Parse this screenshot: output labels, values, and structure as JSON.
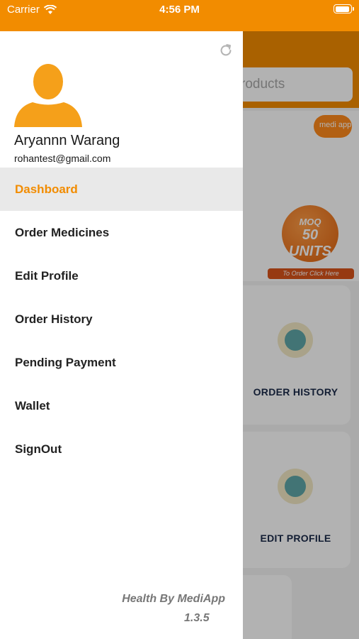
{
  "status_bar": {
    "carrier": "Carrier",
    "time": "4:56 PM",
    "wifi_icon": "wifi-icon",
    "battery_icon": "battery-icon"
  },
  "background": {
    "search_placeholder_partial": "roducts",
    "logo_text": "medi app",
    "moq_line1": "MOQ",
    "moq_line2": "50 UNITS",
    "order_strip": "To Order Click Here",
    "cards": [
      {
        "label": "ORDER HISTORY",
        "icon": "clock-icon"
      },
      {
        "label": "EDIT PROFILE",
        "icon": "profile-icon"
      }
    ]
  },
  "drawer": {
    "refresh_icon": "refresh-icon",
    "avatar_icon": "user-avatar-icon",
    "user_name": "Aryannn Warang",
    "user_email": "rohantest@gmail.com",
    "menu": [
      {
        "label": "Dashboard",
        "active": true
      },
      {
        "label": "Order Medicines",
        "active": false
      },
      {
        "label": "Edit Profile",
        "active": false
      },
      {
        "label": "Order History",
        "active": false
      },
      {
        "label": "Pending Payment",
        "active": false
      },
      {
        "label": "Wallet",
        "active": false
      },
      {
        "label": "SignOut",
        "active": false
      }
    ],
    "footer_brand": "Health By MediApp",
    "footer_version": "1.3.5"
  },
  "colors": {
    "brand": "#f28c00",
    "active_bg": "#e9e9e9"
  }
}
